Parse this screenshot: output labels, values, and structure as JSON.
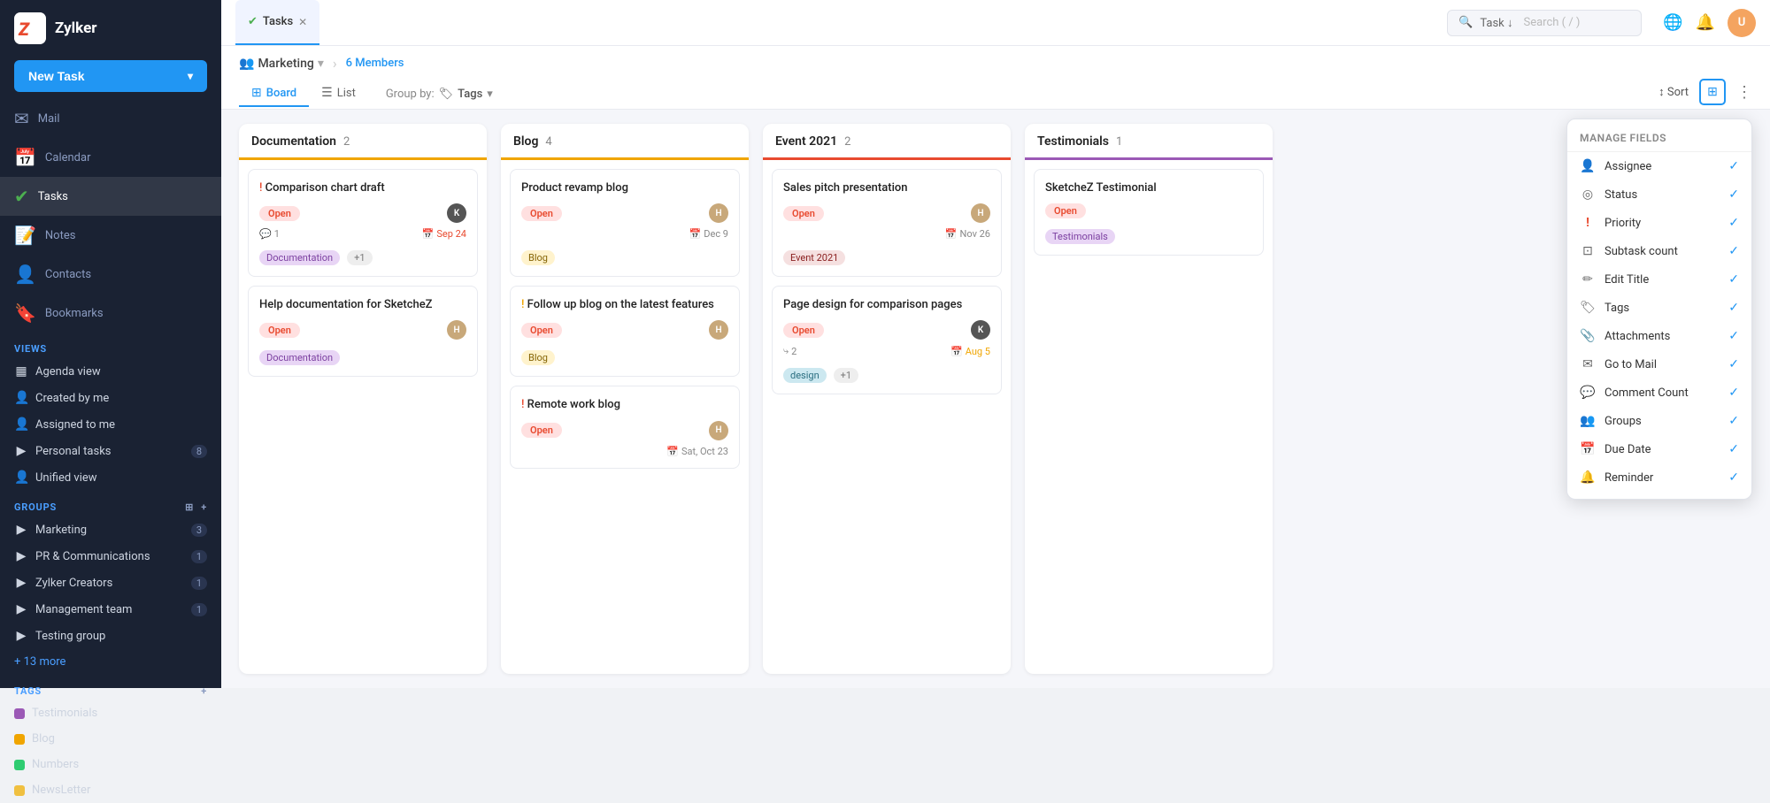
{
  "app": {
    "name": "Zylker",
    "logo_letter": "Z"
  },
  "sidebar": {
    "new_task_label": "New Task",
    "nav_items": [
      {
        "id": "mail",
        "label": "Mail",
        "icon": "✉",
        "active": false
      },
      {
        "id": "calendar",
        "label": "Calendar",
        "icon": "📅",
        "active": false
      },
      {
        "id": "tasks",
        "label": "Tasks",
        "icon": "✔",
        "active": true
      },
      {
        "id": "notes",
        "label": "Notes",
        "icon": "📝",
        "active": false
      },
      {
        "id": "contacts",
        "label": "Contacts",
        "icon": "👤",
        "active": false
      },
      {
        "id": "bookmarks",
        "label": "Bookmarks",
        "icon": "🔖",
        "active": false
      }
    ],
    "views_title": "VIEWS",
    "views": [
      {
        "id": "agenda",
        "label": "Agenda view",
        "icon": "▦"
      },
      {
        "id": "created",
        "label": "Created by me",
        "icon": "👤"
      },
      {
        "id": "assigned",
        "label": "Assigned to me",
        "icon": "👤"
      },
      {
        "id": "personal",
        "label": "Personal tasks",
        "icon": "👤",
        "badge": "8"
      },
      {
        "id": "unified",
        "label": "Unified view",
        "icon": "👤"
      }
    ],
    "groups_title": "GROUPS",
    "groups_add_icon": "+",
    "groups": [
      {
        "id": "marketing",
        "label": "Marketing",
        "badge": "3",
        "expanded": true
      },
      {
        "id": "pr",
        "label": "PR & Communications",
        "badge": "1"
      },
      {
        "id": "zylker",
        "label": "Zylker Creators",
        "badge": "1"
      },
      {
        "id": "mgmt",
        "label": "Management team",
        "badge": "1"
      },
      {
        "id": "testing",
        "label": "Testing group",
        "badge": ""
      }
    ],
    "more_groups": "+ 13 more",
    "tags_title": "TAGS",
    "tags_add_icon": "+",
    "tags": [
      {
        "id": "testimonials",
        "label": "Testimonials",
        "color": "#9b59b6"
      },
      {
        "id": "blog",
        "label": "Blog",
        "color": "#f0a500"
      },
      {
        "id": "numbers",
        "label": "Numbers",
        "color": "#2ecc71"
      },
      {
        "id": "newsletter",
        "label": "NewsLetter",
        "color": "#f0c040"
      }
    ]
  },
  "topbar": {
    "tab_label": "Tasks",
    "tab_icon": "✔",
    "search_label": "Task",
    "search_placeholder": "Search ( / )",
    "bell_icon": "🔔",
    "notif_icon": "🌐",
    "avatar_initials": "U"
  },
  "subheader": {
    "group_name": "Marketing",
    "group_arrow": "›",
    "members_label": "6 Members",
    "board_tab": "Board",
    "list_tab": "List",
    "groupby_label": "Group by:",
    "groupby_icon": "🏷",
    "groupby_value": "Tags",
    "sort_label": "↕ Sort",
    "view_icon": "⊞",
    "more_icon": "⋮"
  },
  "columns": [
    {
      "id": "documentation",
      "title": "Documentation",
      "count": "2",
      "color": "#f0a500",
      "cards": [
        {
          "id": "card1",
          "priority": "!",
          "priority_color": "red",
          "title": "Comparison chart draft",
          "status": "Open",
          "assignee": "Ken",
          "assignee_type": "ken",
          "comment_count": "1",
          "due_date": "Sep 24",
          "due_date_color": "red",
          "tags": [
            "Documentation",
            "+1"
          ],
          "tag_styles": [
            "doc",
            "default"
          ]
        },
        {
          "id": "card2",
          "priority": "",
          "title": "Help documentation for SketcheZ",
          "status": "Open",
          "assignee": "Helen",
          "assignee_type": "helen",
          "tags": [
            "Documentation"
          ],
          "tag_styles": [
            "doc"
          ]
        }
      ]
    },
    {
      "id": "blog",
      "title": "Blog",
      "count": "4",
      "color": "#f0a500",
      "cards": [
        {
          "id": "card3",
          "priority": "",
          "title": "Product revamp blog",
          "status": "Open",
          "assignee": "Helen",
          "assignee_type": "helen",
          "due_date": "Dec 9",
          "due_date_color": "normal",
          "tags": [
            "Blog"
          ],
          "tag_styles": [
            "blog"
          ]
        },
        {
          "id": "card4",
          "priority": "!",
          "priority_color": "yellow",
          "title": "Follow up blog on the latest features",
          "status": "Open",
          "assignee": "Helen",
          "assignee_type": "helen",
          "tags": [
            "Blog"
          ],
          "tag_styles": [
            "blog"
          ]
        },
        {
          "id": "card5",
          "priority": "!",
          "priority_color": "red",
          "title": "Remote work blog",
          "status": "Open",
          "assignee": "Helen",
          "assignee_type": "helen",
          "due_date": "Sat, Oct 23",
          "due_date_color": "normal",
          "tags": [],
          "tag_styles": []
        }
      ]
    },
    {
      "id": "event2021",
      "title": "Event 2021",
      "count": "2",
      "color": "#e84a2f",
      "cards": [
        {
          "id": "card6",
          "priority": "",
          "title": "Sales pitch presentation",
          "status": "Open",
          "assignee": "Helen",
          "assignee_type": "helen",
          "due_date": "Nov 26",
          "due_date_color": "normal",
          "tags": [
            "Event 2021"
          ],
          "tag_styles": [
            "event"
          ]
        },
        {
          "id": "card7",
          "priority": "",
          "title": "Page design for comparison pages",
          "status": "Open",
          "assignee": "Ken",
          "assignee_type": "ken",
          "comment_count": "2",
          "due_date": "Aug 5",
          "due_date_color": "orange",
          "tags": [
            "design",
            "+1"
          ],
          "tag_styles": [
            "default",
            "default"
          ]
        }
      ]
    },
    {
      "id": "testimonials",
      "title": "Testimonials",
      "count": "1",
      "color": "#9b59b6",
      "cards": [
        {
          "id": "card8",
          "priority": "",
          "title": "SketcheZ Testimonial",
          "status": "Open",
          "assignee": "",
          "assignee_type": "",
          "tags": [
            "Testimonials"
          ],
          "tag_styles": [
            "testimonials"
          ]
        }
      ]
    }
  ],
  "manage_fields": {
    "title": "Manage Fields",
    "items": [
      {
        "id": "assignee",
        "label": "Assignee",
        "icon": "👤",
        "checked": true
      },
      {
        "id": "status",
        "label": "Status",
        "icon": "◎",
        "checked": true
      },
      {
        "id": "priority",
        "label": "Priority",
        "icon": "!",
        "checked": true
      },
      {
        "id": "subtask",
        "label": "Subtask count",
        "icon": "⊡",
        "checked": true
      },
      {
        "id": "edittitle",
        "label": "Edit Title",
        "icon": "✏",
        "checked": true
      },
      {
        "id": "tags",
        "label": "Tags",
        "icon": "🏷",
        "checked": true
      },
      {
        "id": "attachments",
        "label": "Attachments",
        "icon": "📎",
        "checked": true
      },
      {
        "id": "gomail",
        "label": "Go to Mail",
        "icon": "✉",
        "checked": true
      },
      {
        "id": "commentcount",
        "label": "Comment Count",
        "icon": "💬",
        "checked": true
      },
      {
        "id": "groups",
        "label": "Groups",
        "icon": "👥",
        "checked": true
      },
      {
        "id": "duedate",
        "label": "Due Date",
        "icon": "📅",
        "checked": true
      },
      {
        "id": "reminder",
        "label": "Reminder",
        "icon": "🔔",
        "checked": true
      }
    ]
  }
}
